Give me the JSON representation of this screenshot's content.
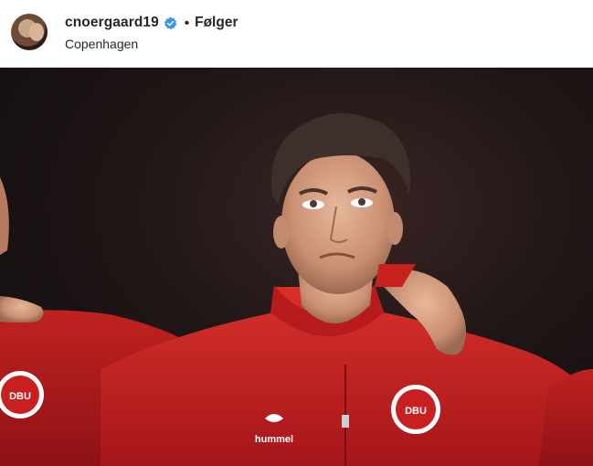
{
  "post_header": {
    "username": "cnoergaard19",
    "separator": "•",
    "follow_label": "Følger",
    "location": "Copenhagen"
  },
  "colors": {
    "verified_badge": "#3897f0",
    "text_primary": "#262626",
    "jersey_red": "#c8201f"
  },
  "icons": {
    "verified": "verified-badge-icon"
  },
  "photo": {
    "crest_text": "DBU",
    "brand_text": "hummel"
  }
}
